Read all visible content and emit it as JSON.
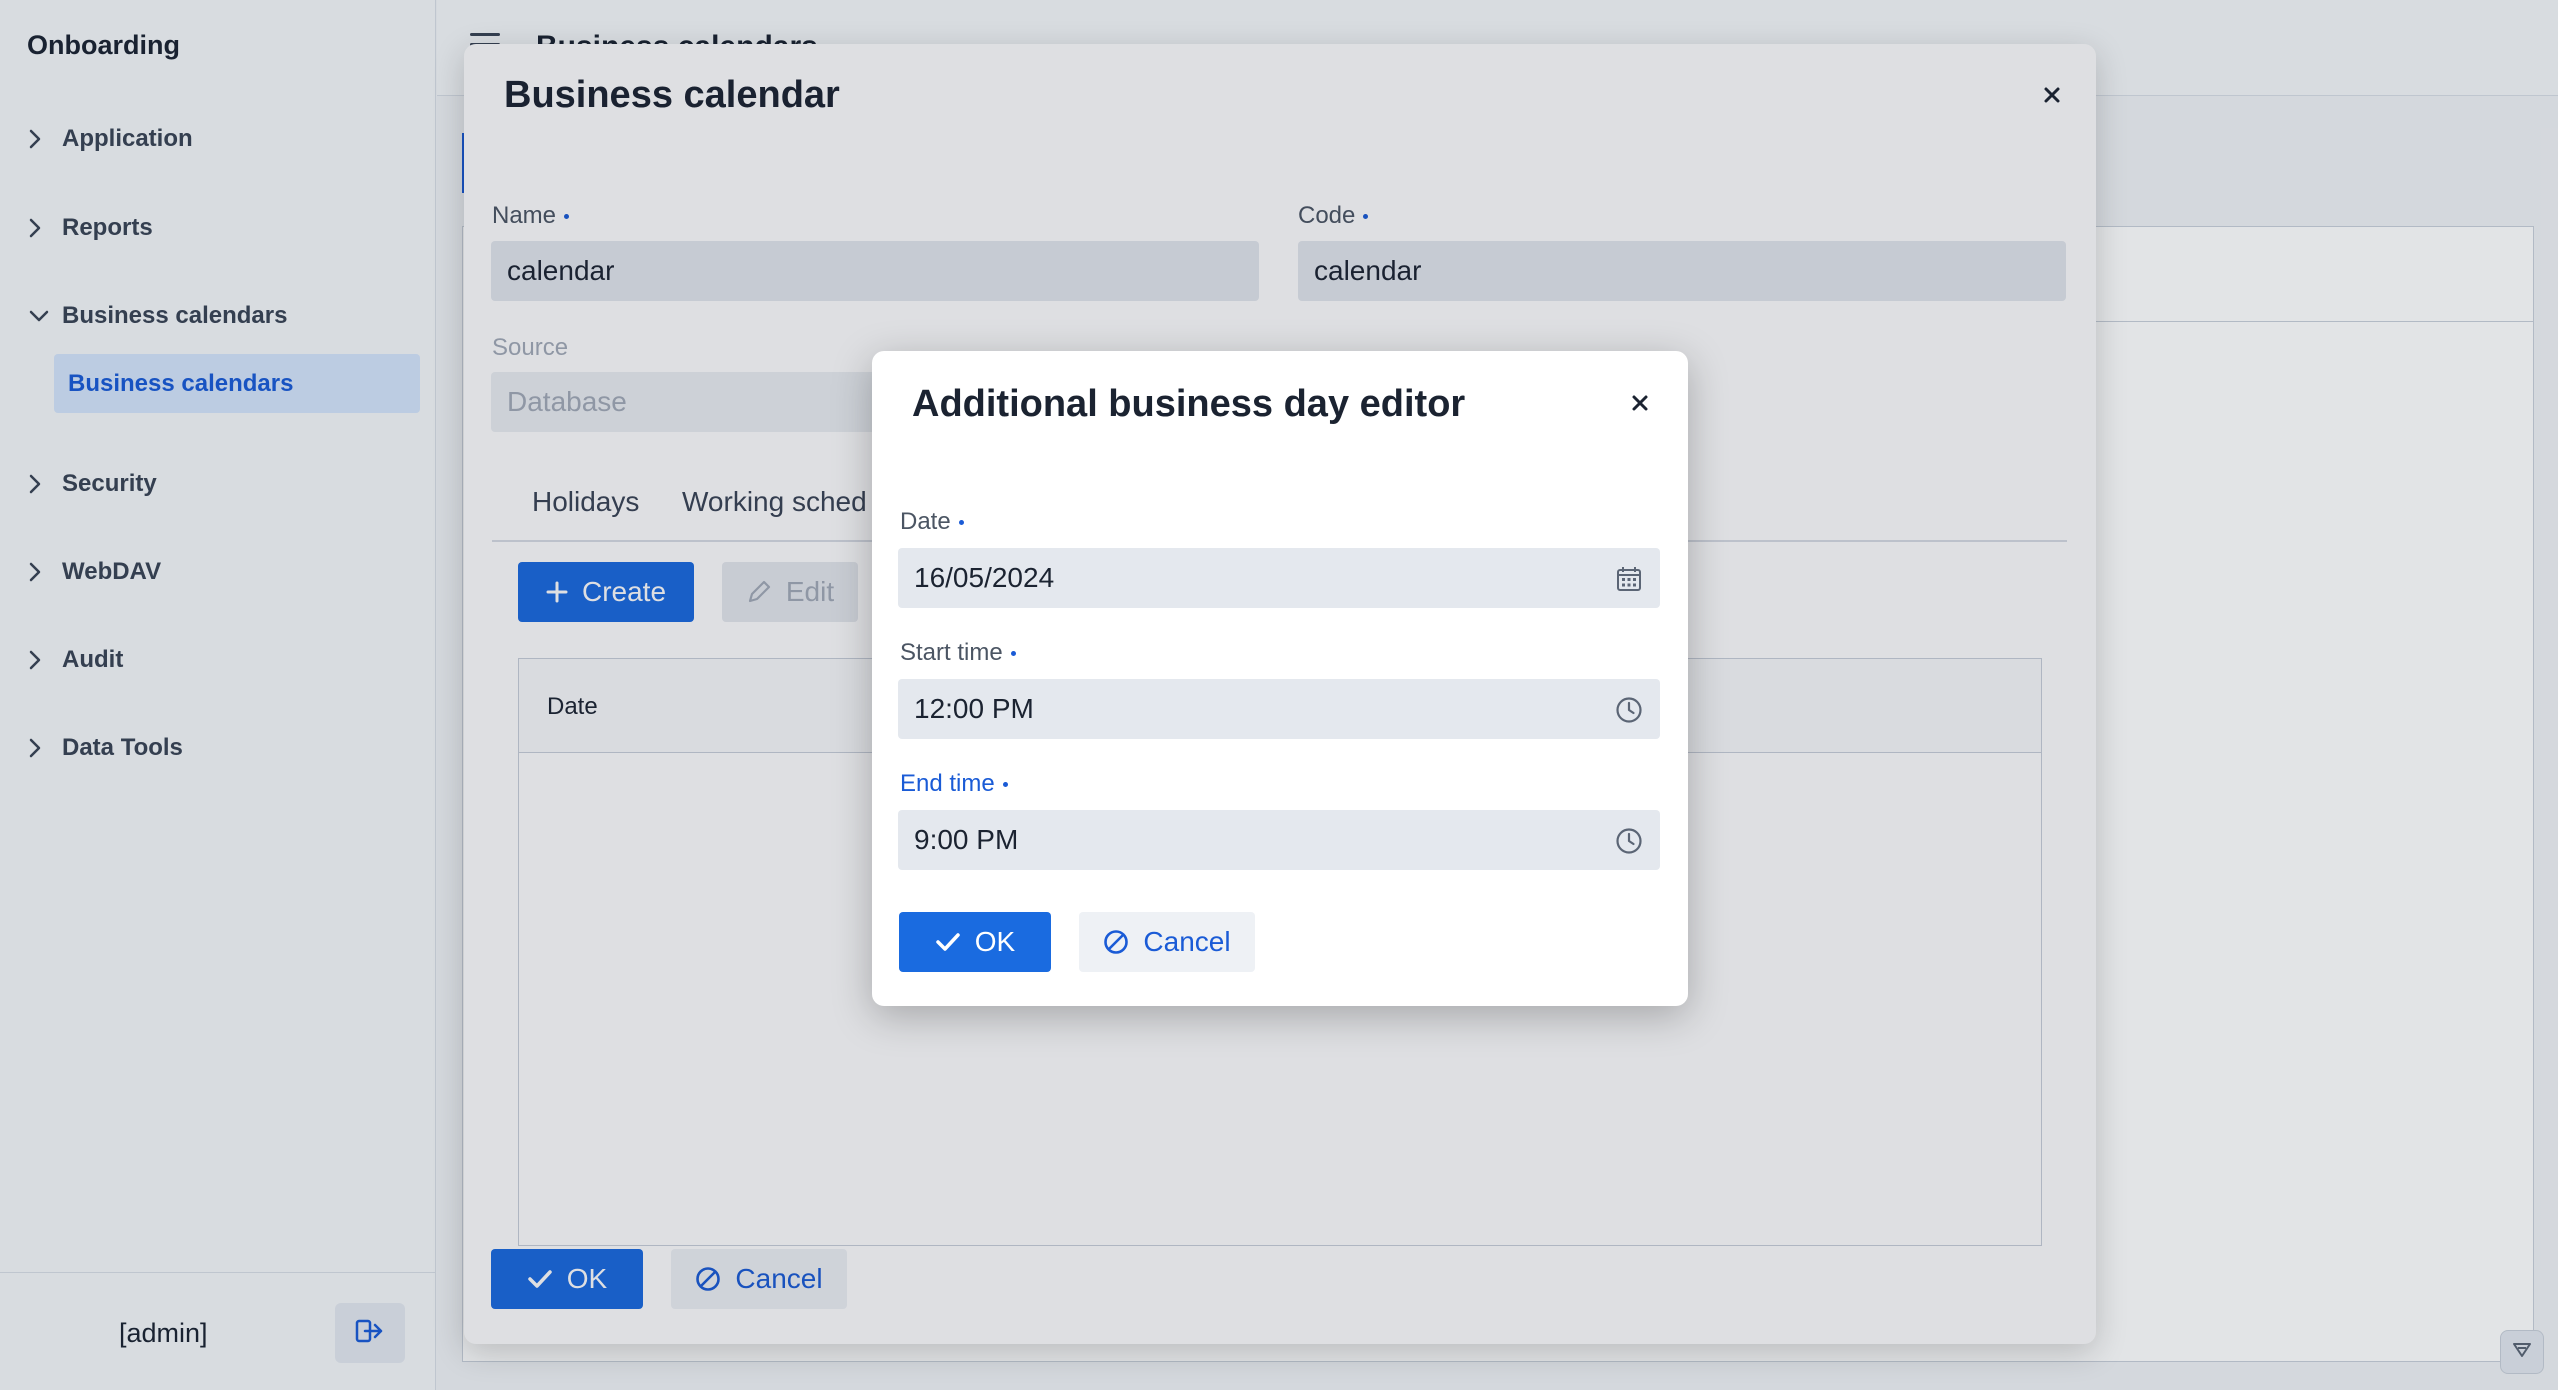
{
  "app": {
    "title": "Onboarding",
    "topbar_title": "Business calendars"
  },
  "sidebar": {
    "items": [
      {
        "label": "Application",
        "expanded": false
      },
      {
        "label": "Reports",
        "expanded": false
      },
      {
        "label": "Business calendars",
        "expanded": true
      },
      {
        "label": "Security",
        "expanded": false
      },
      {
        "label": "WebDAV",
        "expanded": false
      },
      {
        "label": "Audit",
        "expanded": false
      },
      {
        "label": "Data Tools",
        "expanded": false
      }
    ],
    "active_sub_item": "Business calendars",
    "user": "[admin]"
  },
  "dialog": {
    "title": "Business calendar",
    "name_label": "Name",
    "name_value": "calendar",
    "code_label": "Code",
    "code_value": "calendar",
    "source_label": "Source",
    "source_value": "Database",
    "tabs": [
      "Holidays",
      "Working sched"
    ],
    "create_label": "Create",
    "edit_label": "Edit",
    "table_columns": [
      "Date"
    ],
    "ok_label": "OK",
    "cancel_label": "Cancel"
  },
  "editor": {
    "title": "Additional business day editor",
    "date_label": "Date",
    "date_value": "16/05/2024",
    "start_label": "Start time",
    "start_value": "12:00 PM",
    "end_label": "End time",
    "end_value": "9:00 PM",
    "ok_label": "OK",
    "cancel_label": "Cancel"
  },
  "colors": {
    "primary": "#1a6be0",
    "link": "#1a5bd6",
    "input_bg": "#e4e8ee",
    "active_nav_bg": "#d4e4fb"
  },
  "icons": [
    "chevron-right-icon",
    "chevron-down-icon",
    "logout-icon",
    "menu-icon",
    "close-icon",
    "plus-icon",
    "pencil-icon",
    "check-icon",
    "cancel-icon",
    "calendar-icon",
    "clock-icon"
  ]
}
